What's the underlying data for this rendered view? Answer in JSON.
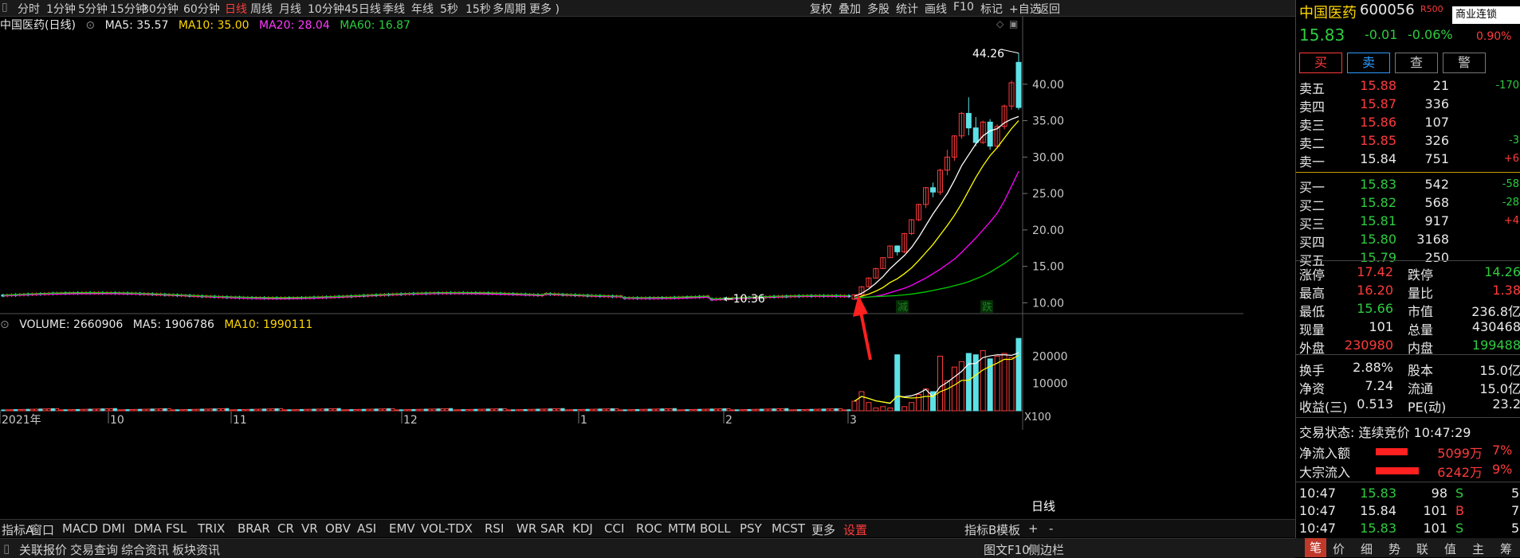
{
  "toolbar": {
    "periods": [
      "分时",
      "1分钟",
      "5分钟",
      "15分钟",
      "30分钟",
      "60分钟",
      "日线",
      "周线",
      "月线",
      "10分钟",
      "45日线",
      "季线",
      "年线",
      "5秒",
      "15秒",
      "多周期",
      "更多 )"
    ],
    "active_period": "日线",
    "right_items": [
      "复权",
      "叠加",
      "多股",
      "统计",
      "画线",
      "F10",
      "标记",
      "+自选",
      "返回"
    ]
  },
  "main_legend": {
    "title": "中国医药(日线)",
    "ma5": "MA5: 35.57",
    "ma10": "MA10: 35.00",
    "ma20": "MA20: 28.04",
    "ma60": "MA60: 16.87"
  },
  "volume_legend": {
    "volume": "VOLUME: 2660906",
    "ma5": "MA5: 1906786",
    "ma10": "MA10: 1990111"
  },
  "chart_data": {
    "type": "candlestick",
    "title": "中国医药(日线)",
    "y_axis_ticks": [
      "40.00",
      "35.00",
      "30.00",
      "25.00",
      "20.00",
      "15.00",
      "10.00"
    ],
    "y_range": [
      9.5,
      45
    ],
    "volume_ticks": [
      "20000",
      "10000"
    ],
    "volume_unit": "X100",
    "x_ticks": [
      "2021年",
      "10",
      "11",
      "12",
      "1",
      "2",
      "3"
    ],
    "annotations": {
      "high_label": "44.26",
      "low_label": "10.36",
      "signal_1": "减",
      "signal_2": "跌"
    },
    "colors": {
      "up": "#ff3b3b",
      "down": "#5ce1e6",
      "ma5": "#ffffff",
      "ma10": "#ffff00",
      "ma20": "#ff00ff",
      "ma60": "#00cc00"
    },
    "recent_candles": [
      {
        "o": 10.5,
        "h": 11.2,
        "l": 10.4,
        "c": 11.1
      },
      {
        "o": 11.1,
        "h": 12.3,
        "l": 11.0,
        "c": 12.2
      },
      {
        "o": 12.2,
        "h": 13.5,
        "l": 12.1,
        "c": 13.4
      },
      {
        "o": 13.4,
        "h": 14.8,
        "l": 13.4,
        "c": 14.7
      },
      {
        "o": 14.7,
        "h": 16.2,
        "l": 14.7,
        "c": 16.2
      },
      {
        "o": 16.2,
        "h": 17.8,
        "l": 16.2,
        "c": 17.8
      },
      {
        "o": 17.8,
        "h": 17.9,
        "l": 16.5,
        "c": 17.0
      },
      {
        "o": 17.0,
        "h": 19.6,
        "l": 16.8,
        "c": 19.5
      },
      {
        "o": 19.5,
        "h": 21.5,
        "l": 19.3,
        "c": 21.4
      },
      {
        "o": 21.4,
        "h": 23.6,
        "l": 21.2,
        "c": 23.5
      },
      {
        "o": 23.5,
        "h": 25.9,
        "l": 23.0,
        "c": 25.8
      },
      {
        "o": 25.8,
        "h": 26.5,
        "l": 24.5,
        "c": 25.2
      },
      {
        "o": 25.2,
        "h": 28.4,
        "l": 24.8,
        "c": 28.2
      },
      {
        "o": 28.2,
        "h": 31.0,
        "l": 27.5,
        "c": 30.0
      },
      {
        "o": 30.0,
        "h": 33.0,
        "l": 29.5,
        "c": 32.9
      },
      {
        "o": 32.9,
        "h": 36.2,
        "l": 32.5,
        "c": 36.0
      },
      {
        "o": 36.0,
        "h": 38.2,
        "l": 33.0,
        "c": 34.0
      },
      {
        "o": 34.0,
        "h": 35.5,
        "l": 31.5,
        "c": 32.0
      },
      {
        "o": 32.0,
        "h": 35.0,
        "l": 31.8,
        "c": 34.8
      },
      {
        "o": 34.8,
        "h": 35.2,
        "l": 31.0,
        "c": 31.5
      },
      {
        "o": 31.5,
        "h": 34.5,
        "l": 31.2,
        "c": 34.2
      },
      {
        "o": 34.2,
        "h": 37.2,
        "l": 33.8,
        "c": 37.0
      },
      {
        "o": 37.0,
        "h": 40.5,
        "l": 36.5,
        "c": 40.2
      },
      {
        "o": 43.0,
        "h": 44.26,
        "l": 36.5,
        "c": 36.8
      }
    ],
    "recent_volume": [
      3500,
      7000,
      3000,
      1000,
      1500,
      1000,
      20500,
      1500,
      3000,
      6000,
      8000,
      7000,
      20000,
      11000,
      16000,
      18000,
      21000,
      20500,
      22000,
      19000,
      20000,
      21000,
      19500,
      26500
    ],
    "ma5_line": [
      10.9,
      11.3,
      11.9,
      12.7,
      13.6,
      14.7,
      15.6,
      16.5,
      17.6,
      19.0,
      20.6,
      22.2,
      23.6,
      25.0,
      26.8,
      28.8,
      30.3,
      31.8,
      32.9,
      33.6,
      33.9,
      34.7,
      35.2,
      35.57
    ],
    "ma10_line": [
      10.6,
      10.9,
      11.2,
      11.6,
      12.1,
      12.8,
      13.3,
      14.0,
      14.8,
      15.8,
      16.9,
      18.0,
      19.3,
      20.6,
      22.0,
      23.6,
      25.4,
      27.2,
      28.8,
      30.2,
      31.3,
      32.6,
      33.9,
      35.0
    ],
    "ma20_line": [
      10.6,
      10.7,
      10.8,
      10.9,
      11.1,
      11.4,
      11.7,
      12.0,
      12.4,
      12.9,
      13.4,
      14.0,
      14.6,
      15.3,
      16.0,
      16.9,
      17.9,
      18.9,
      20.0,
      21.1,
      22.3,
      24.0,
      26.0,
      28.04
    ],
    "ma60_line": [
      10.7,
      10.75,
      10.8,
      10.85,
      10.9,
      10.95,
      11.0,
      11.1,
      11.2,
      11.35,
      11.5,
      11.7,
      11.9,
      12.1,
      12.35,
      12.6,
      12.9,
      13.3,
      13.7,
      14.2,
      14.8,
      15.4,
      16.1,
      16.87
    ]
  },
  "right_panel": {
    "stock_name": "中国医药",
    "stock_code": "600056",
    "badge": "R500",
    "tag": "商业连锁",
    "tag_pct": "0.90%",
    "price": "15.83",
    "change": "-0.01",
    "change_pct": "-0.06%",
    "buttons": [
      "买",
      "卖",
      "查",
      "警"
    ],
    "asks": [
      {
        "label": "卖五",
        "price": "15.88",
        "vol": "21",
        "chg": "-170"
      },
      {
        "label": "卖四",
        "price": "15.87",
        "vol": "336",
        "chg": ""
      },
      {
        "label": "卖三",
        "price": "15.86",
        "vol": "107",
        "chg": ""
      },
      {
        "label": "卖二",
        "price": "15.85",
        "vol": "326",
        "chg": "-3"
      },
      {
        "label": "卖一",
        "price": "15.84",
        "vol": "751",
        "chg": "+6"
      }
    ],
    "bids": [
      {
        "label": "买一",
        "price": "15.83",
        "vol": "542",
        "chg": "-58"
      },
      {
        "label": "买二",
        "price": "15.82",
        "vol": "568",
        "chg": "-28"
      },
      {
        "label": "买三",
        "price": "15.81",
        "vol": "917",
        "chg": "+4"
      },
      {
        "label": "买四",
        "price": "15.80",
        "vol": "3168",
        "chg": ""
      },
      {
        "label": "买五",
        "price": "15.79",
        "vol": "250",
        "chg": ""
      }
    ],
    "stats": [
      {
        "l1": "涨停",
        "v1": "17.42",
        "l2": "跌停",
        "v2": "14.26"
      },
      {
        "l1": "最高",
        "v1": "16.20",
        "l2": "量比",
        "v2": "1.38"
      },
      {
        "l1": "最低",
        "v1": "15.66",
        "l2": "市值",
        "v2": "236.8亿"
      },
      {
        "l1": "现量",
        "v1": "101",
        "l2": "总量",
        "v2": "430468"
      },
      {
        "l1": "外盘",
        "v1": "230980",
        "l2": "内盘",
        "v2": "199488"
      }
    ],
    "stats2": [
      {
        "l1": "换手",
        "v1": "2.88%",
        "l2": "股本",
        "v2": "15.0亿"
      },
      {
        "l1": "净资",
        "v1": "7.24",
        "l2": "流通",
        "v2": "15.0亿"
      },
      {
        "l1": "收益(三)",
        "v1": "0.513",
        "l2": "PE(动)",
        "v2": "23.2"
      }
    ],
    "trade_status": "交易状态: 连续竞价 10:47:29",
    "flow": [
      {
        "label": "净流入额",
        "value": "5099万",
        "pct": "7%"
      },
      {
        "label": "大宗流入",
        "value": "6242万",
        "pct": "9%"
      }
    ],
    "ticks": [
      {
        "time": "10:47",
        "price": "15.83",
        "vol": "98",
        "side": "S",
        "n": "5"
      },
      {
        "time": "10:47",
        "price": "15.84",
        "vol": "101",
        "side": "B",
        "n": "7"
      },
      {
        "time": "10:47",
        "price": "15.83",
        "vol": "101",
        "side": "S",
        "n": "5"
      }
    ],
    "bottom_tabs": [
      "笔",
      "价",
      "细",
      "势",
      "联",
      "值",
      "主",
      "筹"
    ]
  },
  "indicator_bar": {
    "left_label": "指标A",
    "items": [
      "窗口",
      "MACD",
      "DMI",
      "DMA",
      "FSL",
      "TRIX",
      "BRAR",
      "CR",
      "VR",
      "OBV",
      "ASI",
      "EMV",
      "VOL-TDX",
      "RSI",
      "WR",
      "SAR",
      "KDJ",
      "CCI",
      "ROC",
      "MTM",
      "BOLL",
      "PSY",
      "MCST",
      "更多",
      "设置"
    ],
    "right_items": [
      "指标B",
      "模板",
      "+",
      "-"
    ],
    "period_label": "日线"
  },
  "status_bar": {
    "items": [
      "关联报价",
      "交易查询",
      "综合资讯",
      "板块资讯"
    ],
    "right_items": [
      "图文F10",
      "侧边栏"
    ]
  }
}
